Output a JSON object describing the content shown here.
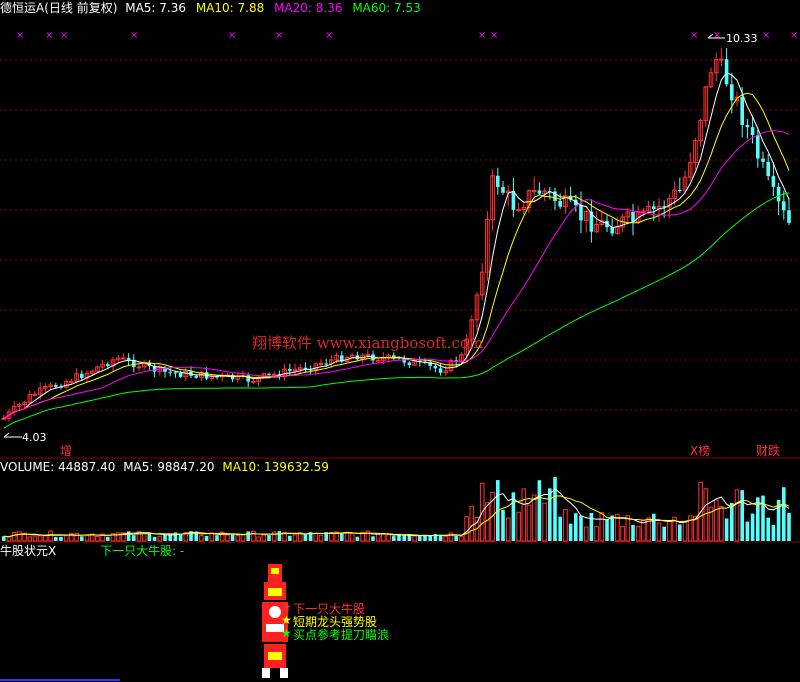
{
  "header": {
    "title": "德恒运A(日线 前复权)",
    "ma5": "MA5: 7.36",
    "ma10": "MA10: 7.88",
    "ma20": "MA20: 8.36",
    "ma60": "MA60: 7.53"
  },
  "price_panel": {
    "high_label": "10.33",
    "low_label": "4.03",
    "watermark": "翔博软件 www.xiangbosoft.com",
    "marker_left": "增",
    "marker_right1": "X榜",
    "marker_right2": "财跌"
  },
  "volume_header": {
    "volume": "VOLUME: 44887.40",
    "ma5": "MA5: 98847.20",
    "ma10": "MA10: 139632.59"
  },
  "indicator_header": {
    "name": "牛股状元X",
    "next": "下一只大牛股: -"
  },
  "legend": {
    "item1": "下一只大牛股",
    "item2": "短期龙头强势股",
    "item3": "买点参考提刀瞄浪"
  },
  "colors": {
    "up": "#ff3232",
    "down": "#54ffff",
    "ma5": "#ffffff",
    "ma10": "#ffff00",
    "ma20": "#ff00ff",
    "ma60": "#00ff00",
    "grid": "#8b0000"
  },
  "chart_data": [
    {
      "type": "candlestick",
      "ylim": [
        4.03,
        10.33
      ],
      "series": [
        {
          "name": "MA5",
          "values": [
            7.36
          ]
        },
        {
          "name": "MA10",
          "values": [
            7.88
          ]
        },
        {
          "name": "MA20",
          "values": [
            8.36
          ]
        },
        {
          "name": "MA60",
          "values": [
            7.53
          ]
        }
      ]
    },
    {
      "type": "bar",
      "series": [
        {
          "name": "VOLUME",
          "values": [
            44887.4
          ]
        },
        {
          "name": "MA5",
          "values": [
            98847.2
          ]
        },
        {
          "name": "MA10",
          "values": [
            139632.59
          ]
        }
      ]
    }
  ]
}
